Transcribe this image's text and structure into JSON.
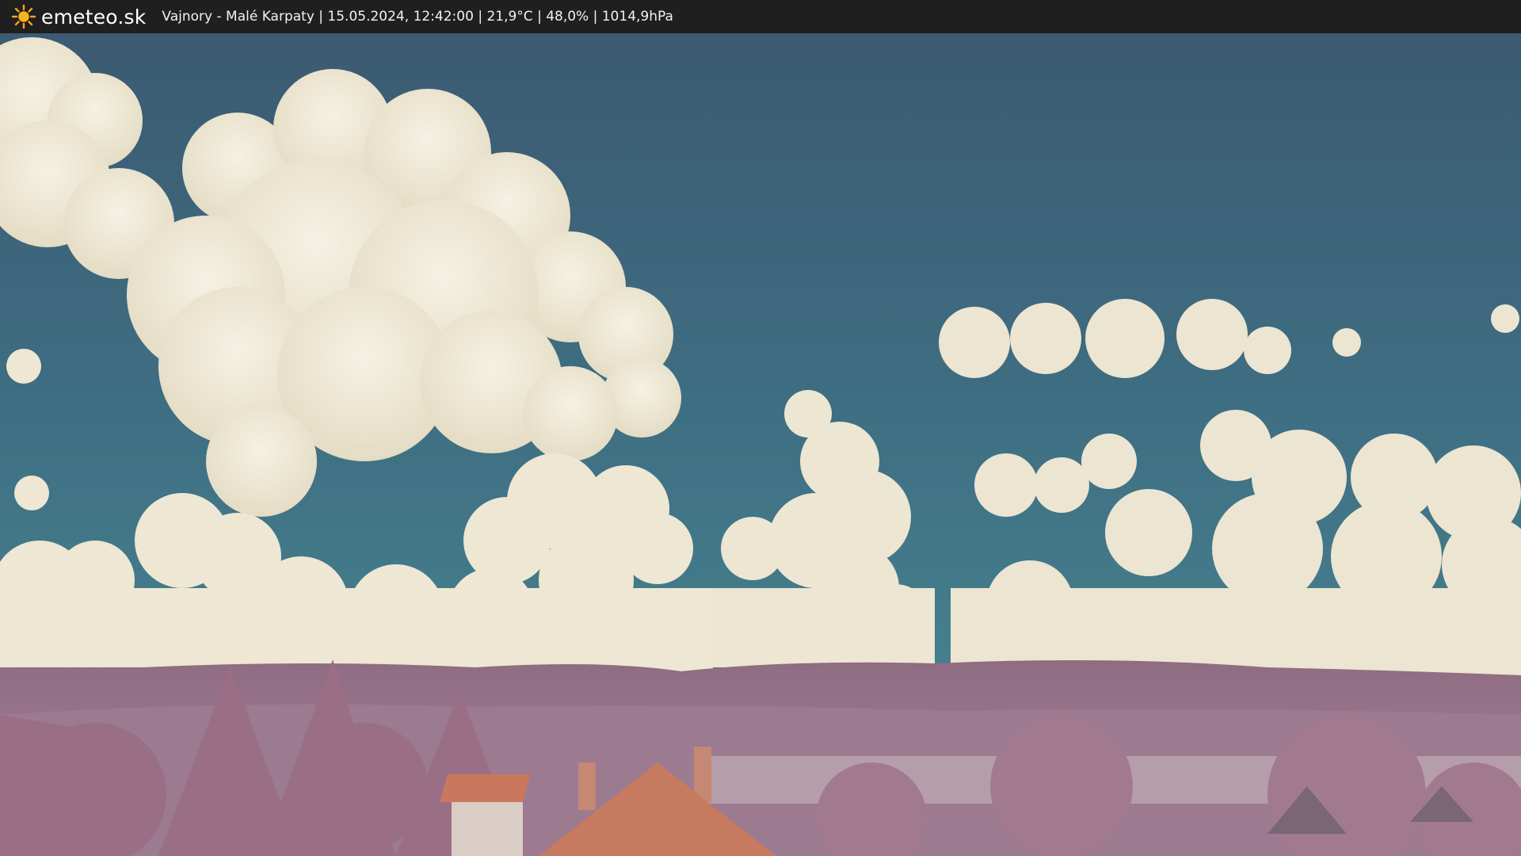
{
  "header": {
    "brand": "emeteo.sk",
    "logo_icon": "sun-icon",
    "caption": "Vajnory - Malé Karpaty | 15.05.2024, 12:42:00 | 21,9°C | 48,0% | 1014,9hPa"
  },
  "colors": {
    "header_bg": "#1f1f1f",
    "sky_top": "#3c5a72",
    "sky_bottom": "#3f8391",
    "cloud": "#f1ecdb",
    "foliage": "#a87a91",
    "roof": "#c9785e"
  }
}
